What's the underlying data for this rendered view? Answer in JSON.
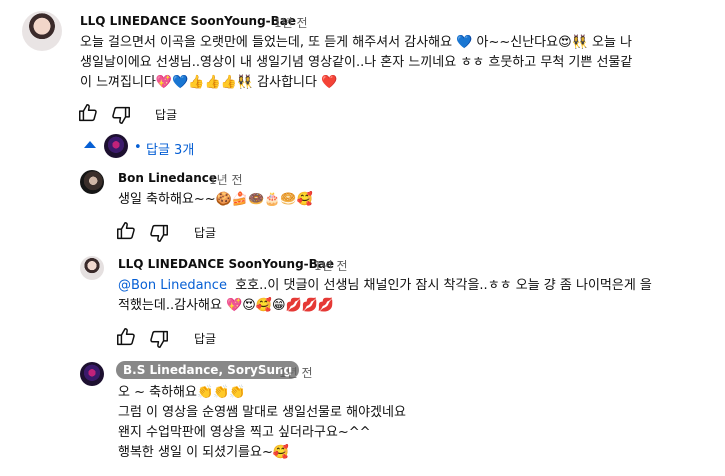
{
  "comment": {
    "author": "LLQ LINEDANCE SoonYoung-Bae",
    "time": "1년 전",
    "line1": "오늘 걸으면서 이곡을 오랫만에 들었는데, 또 듣게 해주셔서 감사해요 💙 아~~신난다요😍👯‍♀️ 오늘 나",
    "line2": "생일날이에요 선생님..영상이 내 생일기념 영상같이..나 혼자 느끼네요 ㅎㅎ 흐뭇하고 무척 기쁜 선물같",
    "line3": "이 느껴집니다💖💙👍👍👍👯‍♀️ 감사합니다 ❤️",
    "reply_label": "답글"
  },
  "replies_toggle": {
    "label": "답글 3개"
  },
  "replies": [
    {
      "author": "Bon Linedance",
      "time": "1년 전",
      "text": "생일 축하해요~~🍪🍰🍩🎂🥯🥰",
      "reply_label": "답글"
    },
    {
      "author": "LLQ LINEDANCE SoonYoung-Bae",
      "time": "1년 전",
      "mention": "@Bon Linedance",
      "line1_rest": "  호호..이 댓글이 선생님 채널인가 잠시 착각을..ㅎㅎ 오늘 걍 좀 나이먹은게 을",
      "line2": "적했는데..감사해요 💖😍🥰😁💋💋💋",
      "reply_label": "답글"
    },
    {
      "author": "B.S Linedance, SorySung",
      "time": "1년 전",
      "line1": "오 ~ 축하해요👏👏👏",
      "line2": "그럼 이 영상을 순영쌤 말대로 생일선물로 해야겠네요",
      "line3": "왠지 수업막판에 영상을 찍고 싶더라구요~^^",
      "line4": "행복한 생일 이 되셨기를요~🥰"
    }
  ],
  "icons": [
    "like-icon",
    "dislike-icon",
    "caret-up-icon"
  ],
  "colors": {
    "link": "#065fd4",
    "secondary": "#606060",
    "chip": "#888888"
  }
}
